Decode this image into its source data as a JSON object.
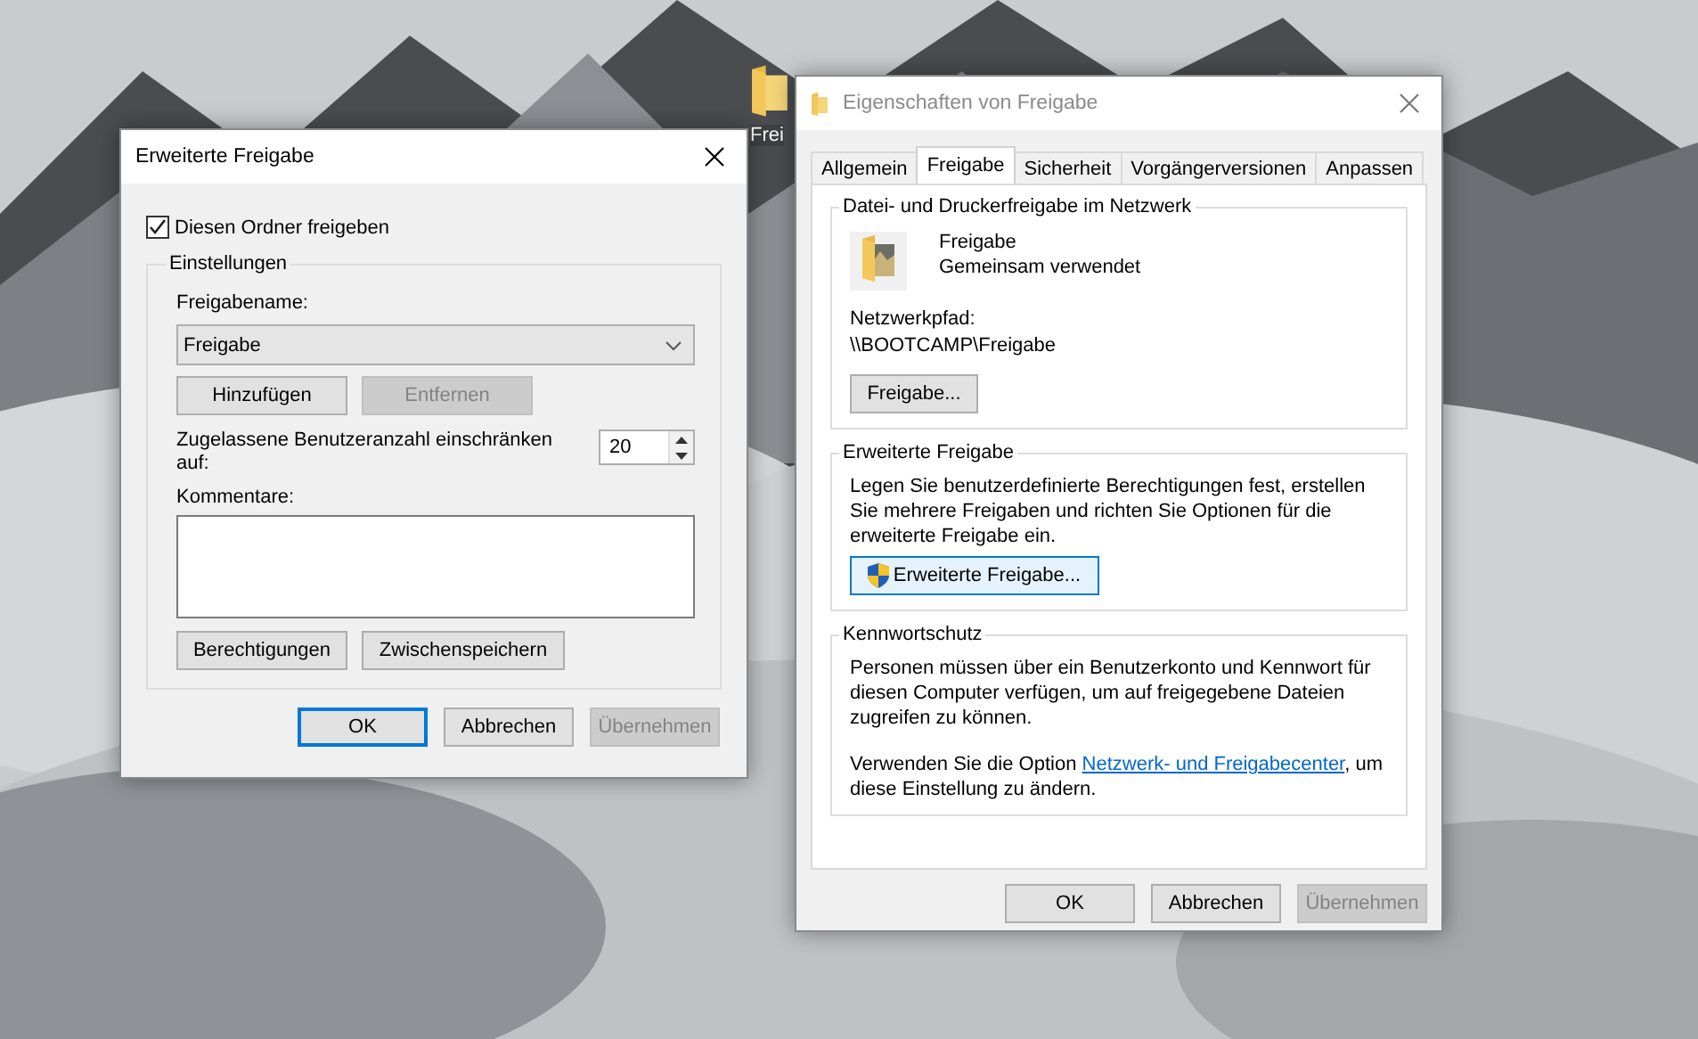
{
  "desktop": {
    "icon_label": "Frei"
  },
  "sharing_dialog": {
    "title": "Erweiterte Freigabe",
    "share_checkbox": {
      "label": "Diesen Ordner freigeben",
      "checked": true
    },
    "group_title": "Einstellungen",
    "share_name_label": "Freigabename:",
    "share_name_value": "Freigabe",
    "name_buttons": [
      {
        "label": "Hinzufügen",
        "disabled": false
      },
      {
        "label": "Entfernen",
        "disabled": true
      }
    ],
    "user_limit_label": "Zugelassene Benutzeranzahl einschränken auf:",
    "user_limit_value": "20",
    "comments_label": "Kommentare:",
    "option_buttons": [
      {
        "label": "Berechtigungen",
        "disabled": false
      },
      {
        "label": "Zwischenspeichern",
        "disabled": false
      }
    ],
    "footer_buttons": [
      {
        "label": "OK",
        "default": true,
        "disabled": false
      },
      {
        "label": "Abbrechen",
        "default": false,
        "disabled": false
      },
      {
        "label": "Übernehmen",
        "default": false,
        "disabled": true
      }
    ]
  },
  "properties_window": {
    "title": "Eigenschaften von Freigabe",
    "tabs": [
      {
        "label": "Allgemein",
        "selected": false
      },
      {
        "label": "Freigabe",
        "selected": true
      },
      {
        "label": "Sicherheit",
        "selected": false
      },
      {
        "label": "Vorgängerversionen",
        "selected": false
      },
      {
        "label": "Anpassen",
        "selected": false
      }
    ],
    "network_sharing": {
      "title": "Datei- und Druckerfreigabe im Netzwerk",
      "name": "Freigabe",
      "status": "Gemeinsam verwendet",
      "path_label": "Netzwerkpfad:",
      "path": "\\\\BOOTCAMP\\Freigabe",
      "button": "Freigabe..."
    },
    "advanced_sharing": {
      "title": "Erweiterte Freigabe",
      "text": "Legen Sie benutzerdefinierte Berechtigungen fest, erstellen Sie mehrere Freigaben und richten Sie Optionen für die erweiterte Freigabe ein.",
      "button": "Erweiterte Freigabe..."
    },
    "password_protection": {
      "title": "Kennwortschutz",
      "text": "Personen müssen über ein Benutzerkonto und Kennwort für diesen Computer verfügen, um auf freigegebene Dateien zugreifen zu können.",
      "hint_before": "Verwenden Sie die Option",
      "hint_link": "Netzwerk- und Freigabecenter",
      "hint_after": ", um diese Einstellung zu ändern."
    },
    "footer_buttons": [
      {
        "label": "OK",
        "default": false,
        "disabled": false
      },
      {
        "label": "Abbrechen",
        "default": false,
        "disabled": false
      },
      {
        "label": "Übernehmen",
        "default": false,
        "disabled": true
      }
    ]
  }
}
